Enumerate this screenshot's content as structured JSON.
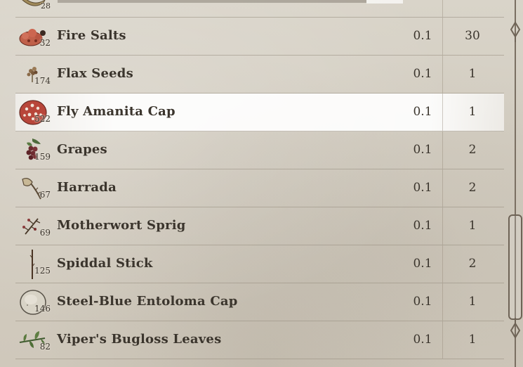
{
  "inventory": {
    "partial_row": {
      "count": "28",
      "icon": "horn-icon"
    },
    "items": [
      {
        "name": "Fire Salts",
        "count": "32",
        "weight": "0.1",
        "value": "30",
        "icon": "fire-salts-icon",
        "selected": false
      },
      {
        "name": "Flax Seeds",
        "count": "174",
        "weight": "0.1",
        "value": "1",
        "icon": "flax-seeds-icon",
        "selected": false
      },
      {
        "name": "Fly Amanita Cap",
        "count": "522",
        "weight": "0.1",
        "value": "1",
        "icon": "fly-amanita-icon",
        "selected": true
      },
      {
        "name": "Grapes",
        "count": "159",
        "weight": "0.1",
        "value": "2",
        "icon": "grapes-icon",
        "selected": false
      },
      {
        "name": "Harrada",
        "count": "67",
        "weight": "0.1",
        "value": "2",
        "icon": "harrada-icon",
        "selected": false
      },
      {
        "name": "Motherwort Sprig",
        "count": "69",
        "weight": "0.1",
        "value": "1",
        "icon": "motherwort-icon",
        "selected": false
      },
      {
        "name": "Spiddal Stick",
        "count": "125",
        "weight": "0.1",
        "value": "2",
        "icon": "spiddal-stick-icon",
        "selected": false
      },
      {
        "name": "Steel-Blue Entoloma Cap",
        "count": "146",
        "weight": "0.1",
        "value": "1",
        "icon": "steel-blue-entoloma-icon",
        "selected": false
      },
      {
        "name": "Viper's Bugloss Leaves",
        "count": "82",
        "weight": "0.1",
        "value": "1",
        "icon": "vipers-bugloss-icon",
        "selected": false
      }
    ]
  },
  "colors": {
    "parchment": "#d6d0c4",
    "text": "#3b352d",
    "divider": "#968c7d",
    "selection": "#ffffff",
    "scroll": "#6e6356"
  }
}
